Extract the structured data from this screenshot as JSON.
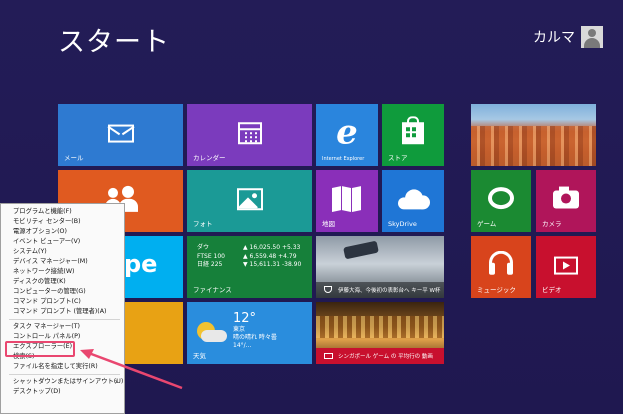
{
  "screen": {
    "title": "スタート",
    "user_name": "カルマ"
  },
  "tiles": {
    "mail": "メール",
    "calendar": "カレンダー",
    "ie": "Internet Explorer",
    "store": "ストア",
    "photos": "フォト",
    "maps": "地図",
    "skydrive": "SkyDrive",
    "games": "ゲーム",
    "camera": "カメラ",
    "music": "ミュージック",
    "video": "ビデオ",
    "finance": "ファイナンス",
    "weather": "天気",
    "sports": "伊藤大海、今後初の表彰台へ キー平 W杯",
    "travel": "シンガポール ゲーム の 平均行の 動画",
    "skype": "Skype",
    "skype_partial": "pe"
  },
  "finance": {
    "rows": [
      {
        "name": "ダウ",
        "value": "▲ 16,025.50 +5.33"
      },
      {
        "name": "FTSE 100",
        "value": "▲ 6,559.48 +4.79"
      },
      {
        "name": "日経 225",
        "value": "▼ 15,611.31 -38.90"
      }
    ]
  },
  "weather": {
    "temp": "12°",
    "city": "東京",
    "condition": "晴の晴れ 時々曇",
    "range": "14°/..."
  },
  "context_menu": {
    "items": [
      "プログラムと機能(F)",
      "モビリティ センター(B)",
      "電源オプション(O)",
      "イベント ビューアー(V)",
      "システム(Y)",
      "デバイス マネージャー(M)",
      "ネットワーク接続(W)",
      "ディスクの管理(K)",
      "コンピューターの管理(G)",
      "コマンド プロンプト(C)",
      "コマンド プロンプト (管理者)(A)",
      "タスク マネージャー(T)",
      "コントロール パネル(P)",
      "エクスプローラー(E)",
      "検索(S)",
      "ファイル名を指定して実行(R)",
      "シャットダウンまたはサインアウト(U)",
      "デスクトップ(D)"
    ]
  },
  "colors": {
    "background": "#221b56",
    "mail": "#2e7ad1",
    "calendar": "#7b3bbd",
    "ie": "#2a85dd",
    "store": "#0f9b3c",
    "people": "#e05a20",
    "photos": "#1b9a96",
    "maps": "#8a2fb9",
    "skydrive": "#1f76d6",
    "games": "#1b8a32",
    "camera": "#b0155a",
    "music": "#d8441c",
    "video": "#c8102e",
    "finance": "#16803a",
    "weather": "#2a8ddd",
    "highlight": "#e94770"
  }
}
